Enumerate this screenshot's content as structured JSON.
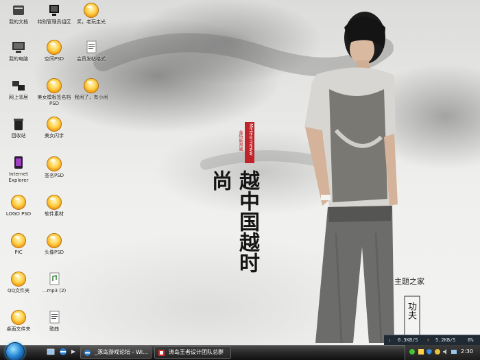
{
  "desktop": {
    "icons": [
      {
        "label": "我的文档",
        "kind": "my-documents"
      },
      {
        "label": "我的电脑",
        "kind": "my-computer"
      },
      {
        "label": "网上邻居",
        "kind": "network-places"
      },
      {
        "label": "回收站",
        "kind": "recycle-bin"
      },
      {
        "label": "Internet Explorer",
        "kind": "internet-explorer"
      },
      {
        "label": "LOGO PSD",
        "kind": "psd-bowl"
      },
      {
        "label": "PIC",
        "kind": "psd-bowl"
      },
      {
        "label": "QQ文件夹",
        "kind": "psd-bowl"
      },
      {
        "label": "桌面文件夹",
        "kind": "psd-bowl"
      },
      {
        "label": "特别管理员组区",
        "kind": "shortcut-monitor"
      },
      {
        "label": "空间PSD",
        "kind": "psd-bowl"
      },
      {
        "label": "美女模板签名档PSD",
        "kind": "psd-bowl"
      },
      {
        "label": "美女闪字",
        "kind": "psd-bowl"
      },
      {
        "label": "签名PSD",
        "kind": "psd-bowl"
      },
      {
        "label": "软件素材",
        "kind": "psd-bowl"
      },
      {
        "label": "头像PSD",
        "kind": "psd-bowl"
      },
      {
        "label": "...mp3 (2)",
        "kind": "mp3-file"
      },
      {
        "label": "歌曲",
        "kind": "text-file"
      },
      {
        "label": "奖，老玩走光",
        "kind": "psd-bowl"
      },
      {
        "label": "会员发帖格式",
        "kind": "text-file"
      },
      {
        "label": "我闲了，有小闲",
        "kind": "psd-bowl"
      }
    ]
  },
  "wallpaper": {
    "calligraphy": "越中国越时尚",
    "seal_red": "Meteormeww",
    "seal_small": "美特斯邦威",
    "watermark": "主题之家",
    "scroll_text": "功夫"
  },
  "taskbar": {
    "tasks": [
      {
        "label": "_涿岛游戏论坛 - Wi...",
        "active": true
      },
      {
        "label": "涛岛王者设计团队总群",
        "active": false
      }
    ],
    "net_down": "0.3KB/S",
    "net_up": "5.2KB/S",
    "cpu": "8%",
    "clock": "2:30"
  },
  "colors": {
    "taskbar": "#2a2a2a",
    "seal_red": "#c0242a",
    "net_down_arrow": "#4bd14b",
    "net_up_arrow": "#e6b52a"
  }
}
